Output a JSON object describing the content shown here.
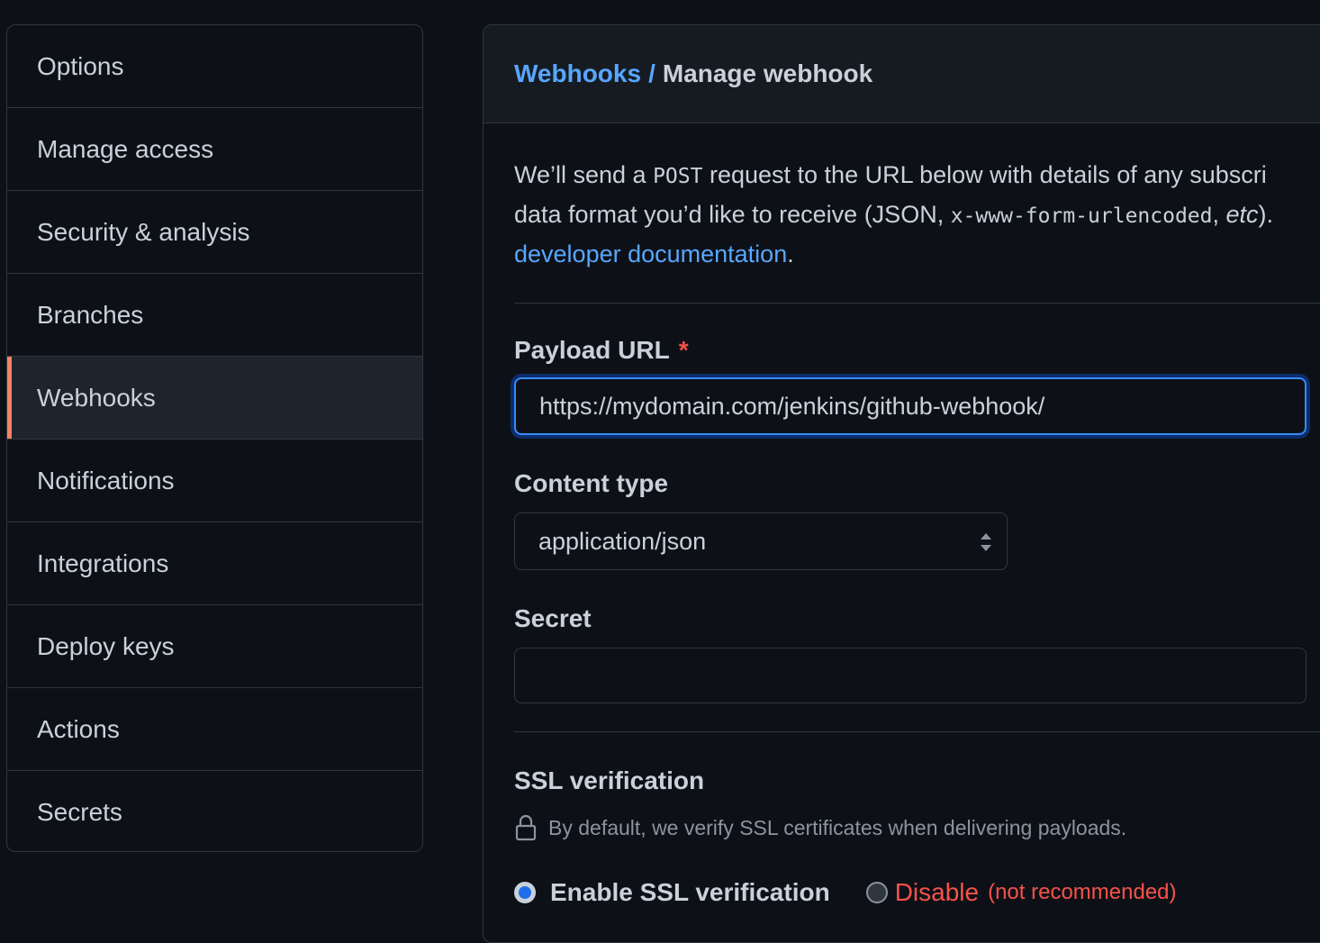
{
  "sidebar": {
    "items": [
      {
        "label": "Options"
      },
      {
        "label": "Manage access"
      },
      {
        "label": "Security & analysis"
      },
      {
        "label": "Branches"
      },
      {
        "label": "Webhooks",
        "active": true
      },
      {
        "label": "Notifications"
      },
      {
        "label": "Integrations"
      },
      {
        "label": "Deploy keys"
      },
      {
        "label": "Actions"
      },
      {
        "label": "Secrets"
      }
    ]
  },
  "breadcrumb": {
    "parent": "Webhooks",
    "separator": "/",
    "current": "Manage webhook"
  },
  "intro": {
    "line1_a": "We’ll send a ",
    "line1_code": "POST",
    "line1_b": " request to the URL below with details of any subscri",
    "line2_a": "data format you’d like to receive (JSON, ",
    "line2_code": "x-www-form-urlencoded",
    "line2_b": ", ",
    "line2_em": "etc",
    "line2_c": ").",
    "line3_link": "developer documentation",
    "line3_end": "."
  },
  "payload_url": {
    "label": "Payload URL",
    "required_mark": "*",
    "value": "https://mydomain.com/jenkins/github-webhook/"
  },
  "content_type": {
    "label": "Content type",
    "selected": "application/json"
  },
  "secret": {
    "label": "Secret",
    "value": ""
  },
  "ssl": {
    "title": "SSL verification",
    "note": "By default, we verify SSL certificates when delivering payloads.",
    "enable_label": "Enable SSL verification",
    "disable_label": "Disable",
    "disable_hint": "(not recommended)",
    "selected": "enable"
  },
  "colors": {
    "background": "#0d1117",
    "accent_link": "#58a6ff",
    "active_indicator": "#f78166",
    "danger": "#f85149",
    "focus_ring": "#388bfd"
  }
}
